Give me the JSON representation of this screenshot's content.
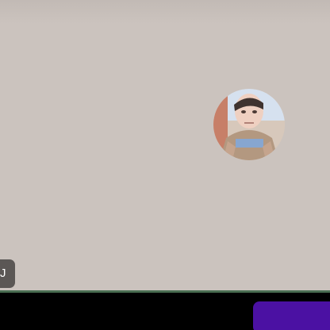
{
  "participant": {
    "name_initial": "J",
    "avatar_description": "profile photo"
  },
  "toolbar": {
    "primary_button_label": ""
  },
  "colors": {
    "background": "#cbc3be",
    "name_chip": "#5b5755",
    "divider": "#4a6e52",
    "toolbar_background": "#000000",
    "primary_button": "#4b11a3"
  }
}
